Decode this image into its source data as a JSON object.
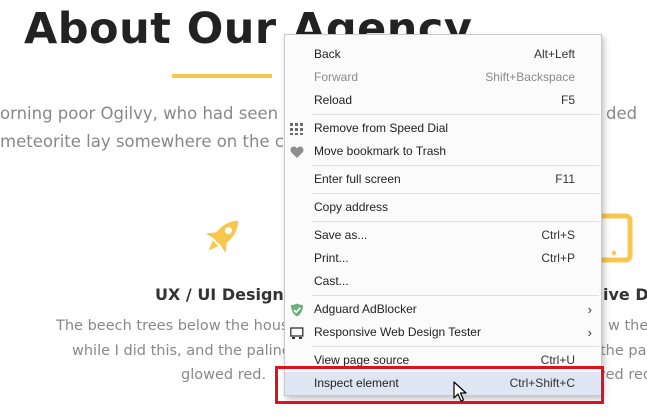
{
  "page": {
    "title": "About Our Agency",
    "intro_line1": "orning poor Ogilvy, who had seen",
    "intro_line2": "meteorite lay somewhere on the c",
    "intro_right": "ded",
    "services": {
      "left_title": "UX / UI Design",
      "right_title": "ive D",
      "left_text": [
        "The beech trees below the hous",
        "while I did this, and the palings",
        "glowed red."
      ],
      "right_text": [
        "w the h",
        "the pal",
        "ved red"
      ],
      "icons": [
        "rocket-icon",
        "tablet-icon"
      ]
    },
    "accent_color": "#f7c74f"
  },
  "context_menu": {
    "items": [
      {
        "label": "Back",
        "shortcut": "Alt+Left"
      },
      {
        "label": "Forward",
        "shortcut": "Shift+Backspace",
        "disabled": true
      },
      {
        "label": "Reload",
        "shortcut": "F5"
      },
      {
        "label": "Remove from Speed Dial",
        "icon": "speed-dial-icon"
      },
      {
        "label": "Move bookmark to Trash",
        "icon": "heart-icon"
      },
      {
        "label": "Enter full screen",
        "shortcut": "F11"
      },
      {
        "label": "Copy address"
      },
      {
        "label": "Save as...",
        "shortcut": "Ctrl+S"
      },
      {
        "label": "Print...",
        "shortcut": "Ctrl+P"
      },
      {
        "label": "Cast..."
      },
      {
        "label": "Adguard AdBlocker",
        "icon": "adguard-shield-icon",
        "submenu": true
      },
      {
        "label": "Responsive Web Design Tester",
        "icon": "responsive-tester-icon",
        "submenu": true
      },
      {
        "label": "View page source",
        "shortcut": "Ctrl+U"
      },
      {
        "label": "Inspect element",
        "shortcut": "Ctrl+Shift+C",
        "highlighted": true
      }
    ],
    "submenu_arrow": "›"
  },
  "highlight_color": "#e0101d"
}
